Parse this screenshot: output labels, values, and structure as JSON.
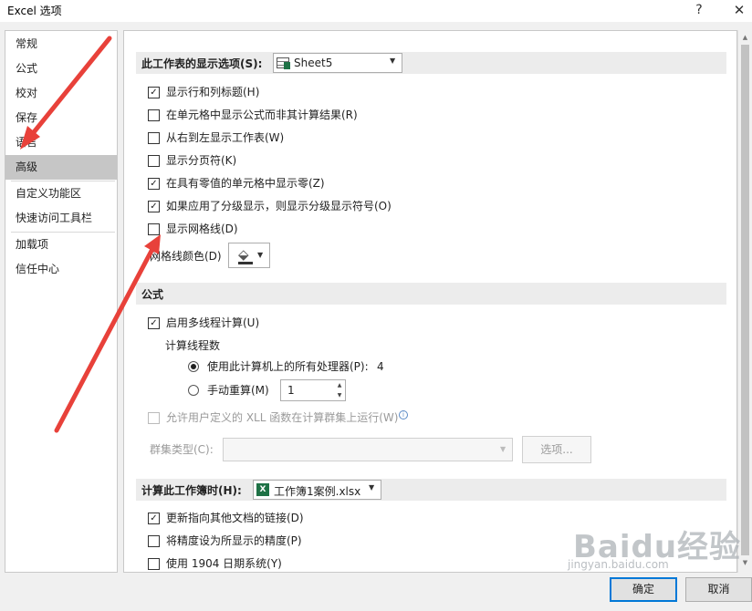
{
  "window": {
    "title": "Excel 选项",
    "help_glyph": "?",
    "close_glyph": "✕"
  },
  "sidebar": {
    "items": [
      {
        "label": "常规"
      },
      {
        "label": "公式"
      },
      {
        "label": "校对"
      },
      {
        "label": "保存"
      },
      {
        "label": "语言"
      },
      {
        "label": "高级",
        "selected": true
      },
      {
        "label": "自定义功能区"
      },
      {
        "label": "快速访问工具栏"
      },
      {
        "label": "加载项"
      },
      {
        "label": "信任中心"
      }
    ]
  },
  "sheet_section": {
    "title": "此工作表的显示选项(S):",
    "selected_sheet": "Sheet5",
    "options": [
      {
        "label": "显示行和列标题(H)",
        "checked": true
      },
      {
        "label": "在单元格中显示公式而非其计算结果(R)",
        "checked": false
      },
      {
        "label": "从右到左显示工作表(W)",
        "checked": false
      },
      {
        "label": "显示分页符(K)",
        "checked": false
      },
      {
        "label": "在具有零值的单元格中显示零(Z)",
        "checked": true
      },
      {
        "label": "如果应用了分级显示，则显示分级显示符号(O)",
        "checked": true
      },
      {
        "label": "显示网格线(D)",
        "checked": false
      }
    ],
    "gridline_color_label": "网格线颜色(D)"
  },
  "formula_section": {
    "title": "公式",
    "multithread": {
      "label": "启用多线程计算(U)",
      "checked": true
    },
    "thread_count_label": "计算线程数",
    "all_processors": {
      "label": "使用此计算机上的所有处理器(P):",
      "value": "4",
      "selected": true
    },
    "manual": {
      "label": "手动重算(M)",
      "value": "1",
      "selected": false
    },
    "xll_option": {
      "label": "允许用户定义的 XLL 函数在计算群集上运行(W)",
      "checked": false,
      "enabled": false
    },
    "cluster_type_label": "群集类型(C):",
    "options_button": "选项..."
  },
  "workbook_section": {
    "title": "计算此工作簿时(H):",
    "selected_workbook": "工作簿1案例.xlsx",
    "options": [
      {
        "label": "更新指向其他文档的链接(D)",
        "checked": true
      },
      {
        "label": "将精度设为所显示的精度(P)",
        "checked": false
      },
      {
        "label": "使用 1904 日期系统(Y)",
        "checked": false
      }
    ]
  },
  "footer": {
    "ok": "确定",
    "cancel": "取消"
  },
  "watermark": {
    "brand": "Baidu经验",
    "url": "jingyan.baidu.com"
  },
  "colors": {
    "annotation_arrow": "#e8413a",
    "selected_nav": "#c6c6c6",
    "excel_green": "#1e7145"
  }
}
